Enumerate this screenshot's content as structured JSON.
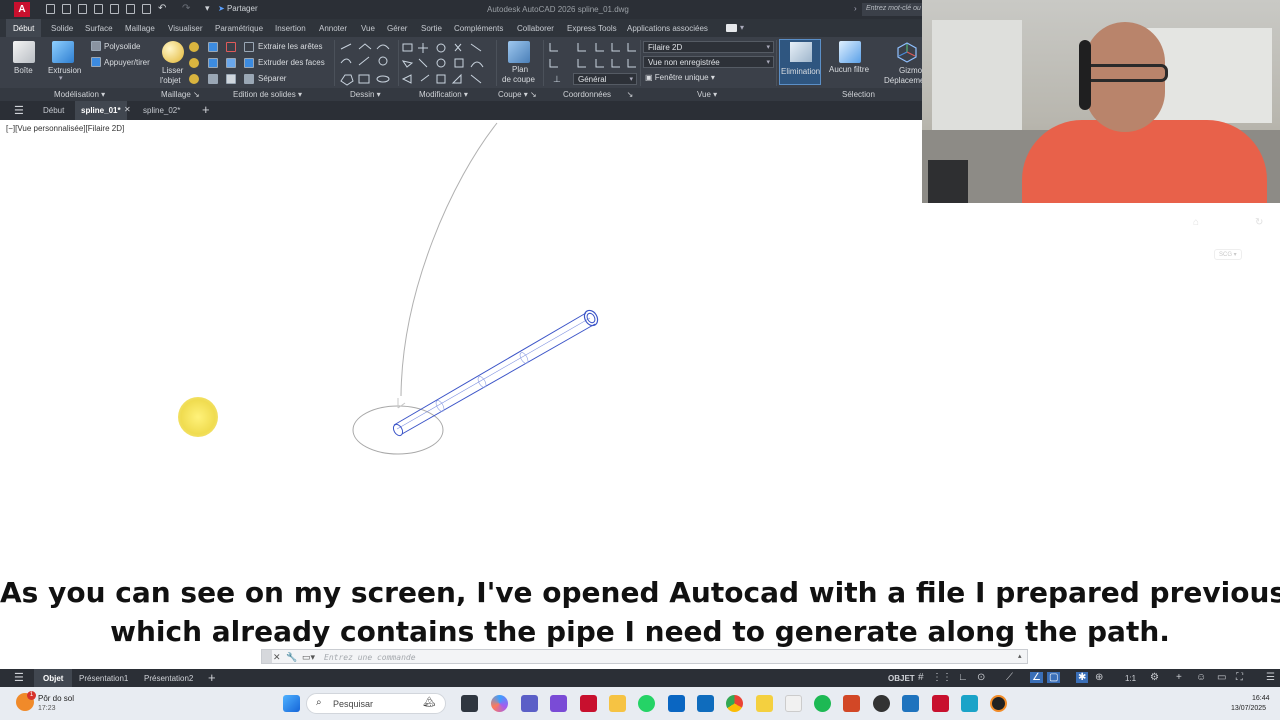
{
  "app": {
    "logo_letter": "A",
    "title": "Autodesk AutoCAD 2026   spline_01.dwg",
    "share_label": "Partager",
    "search_placeholder": "Entrez mot-clé ou"
  },
  "ribbon_tabs": [
    "Début",
    "Solide",
    "Surface",
    "Maillage",
    "Visualiser",
    "Paramétrique",
    "Insertion",
    "Annoter",
    "Vue",
    "Gérer",
    "Sortie",
    "Compléments",
    "Collaborer",
    "Express Tools",
    "Applications associées"
  ],
  "ribbon": {
    "modelisation": {
      "boite": "Boîte",
      "extrusion": "Extrusion",
      "polysolide": "Polysolide",
      "appuyer": "Appuyer/tirer"
    },
    "maillage": {
      "lisser_1": "Lisser",
      "lisser_2": "l'objet"
    },
    "edition": {
      "extraire_aretes": "Extraire les arêtes",
      "extruder_faces": "Extruder des faces",
      "separer": "Séparer"
    },
    "coupe": {
      "plan_1": "Plan",
      "plan_2": "de coupe"
    },
    "coordonnees": {
      "general": "Général"
    },
    "vue": {
      "style": "Filaire 2D",
      "vue_nom": "Vue non enregistrée",
      "fenetre": "Fenêtre unique"
    },
    "selection": {
      "elimination": "Elimination",
      "aucun_filtre": "Aucun filtre",
      "gizmo_1": "Gizmo",
      "gizmo_2": "Déplacement"
    },
    "panels": [
      "Modélisation",
      "Maillage",
      "Edition de solides",
      "Dessin",
      "Modification",
      "Coupe",
      "Coordonnées",
      "Vue",
      "Sélection"
    ]
  },
  "doc_tabs": {
    "home": "Début",
    "active": "spline_01*",
    "other": "spline_02*"
  },
  "viewport_label": "[−][Vue personnalisée][Filaire 2D]",
  "viewcube_label": "SCG",
  "caption": {
    "line1": "As you can see on my screen, I've opened Autocad with a file I prepared previously,",
    "line2": "which already contains the pipe I need to generate along the path."
  },
  "command_placeholder": "Entrez une commande",
  "layout_tabs": [
    "Objet",
    "Présentation1",
    "Présentation2"
  ],
  "status": {
    "objet": "OBJET",
    "scale": "1:1"
  },
  "taskbar": {
    "weather_title": "Pôr do sol",
    "weather_time": "17:23",
    "search_label": "Pesquisar",
    "clock_time": "16:44",
    "clock_date": "13/07/2025"
  },
  "colors": {
    "accent_blue": "#4a6bd6",
    "autocad_red": "#c8102e",
    "ribbon_bg": "#3b4049",
    "highlight": "#f5e66a"
  }
}
